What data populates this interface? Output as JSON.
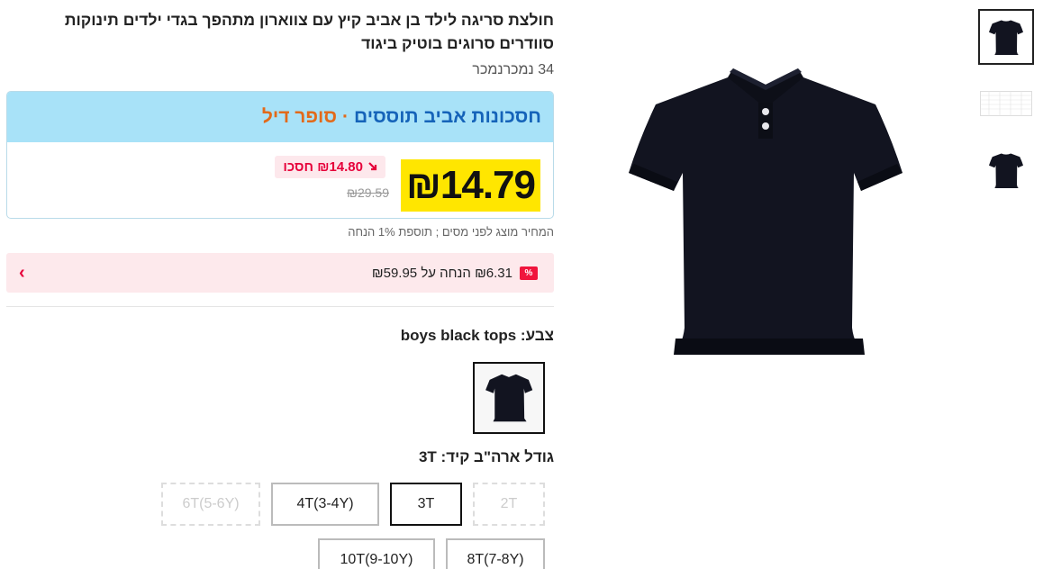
{
  "product": {
    "title": "חולצת סריגה לילד בן אביב קיץ עם צווארון מתהפך בגדי ילדים תינוקות סוודרים סרוגים בוטיק ביגוד",
    "sold_text": "34 נמכרנמכר"
  },
  "price_card": {
    "brand": "חסכונות אביב תוססים",
    "separator": "·",
    "deal": "סופר דיל",
    "price": "₪14.79",
    "save_label": "₪14.80 חסכו",
    "old_price": "₪29.59"
  },
  "tax_note": "המחיר מוצג לפני מסים ; תוספת 1% הנחה",
  "coupon": {
    "badge": "%",
    "text": "₪6.31 הנחה על ₪59.95",
    "chevron": "›"
  },
  "color": {
    "label": "צבע: boys black tops"
  },
  "size": {
    "label": "גודל ארה\"ב קיד: 3T",
    "options": [
      {
        "label": "2T",
        "state": "unavailable"
      },
      {
        "label": "3T",
        "state": "selected"
      },
      {
        "label": "4T(3-4Y)",
        "state": "available"
      },
      {
        "label": "6T(5-6Y)",
        "state": "unavailable"
      },
      {
        "label": "8T(7-8Y)",
        "state": "available"
      },
      {
        "label": "10T(9-10Y)",
        "state": "available"
      }
    ]
  },
  "colors": {
    "price_highlight": "#ffe600",
    "header_bg": "#a8e2f8",
    "brand_blue": "#1563b9",
    "deal_orange": "#e26a1a",
    "sale_red": "#e6003a",
    "shirt": "#121420"
  }
}
